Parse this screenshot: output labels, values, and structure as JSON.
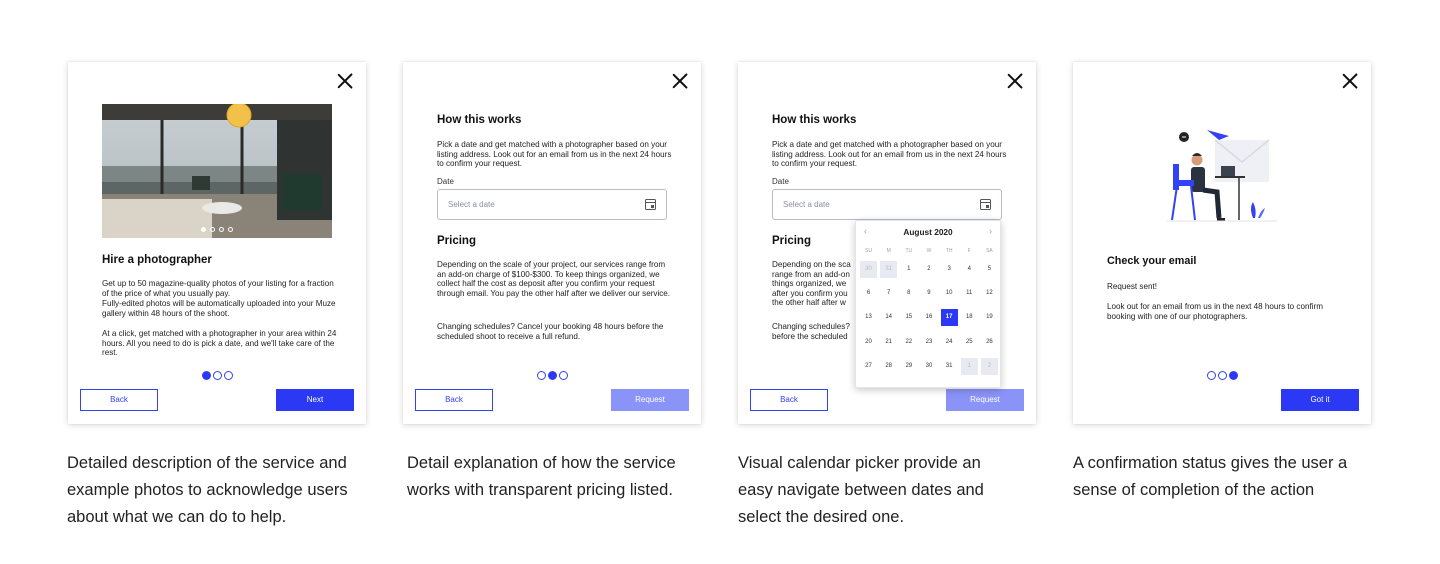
{
  "close_label": "×",
  "card1": {
    "title": "Hire a photographer",
    "para1": "Get up to 50 magazine-quality photos of your listing for a fraction of the price of what you usually pay.",
    "para2": "Fully-edited photos will be automatically uploaded into your Muze gallery within 48 hours of the shoot.",
    "para3": "At a click, get matched with a photographer in your area within 24 hours. All you need to do is pick a date, and we'll take care of the rest.",
    "back_label": "Back",
    "next_label": "Next",
    "step": 1
  },
  "card2": {
    "how_title": "How this works",
    "how_text": "Pick a date and get matched with a photographer based on your listing address. Look out for an email from us in the next 24 hours to confirm your request.",
    "date_label": "Date",
    "date_placeholder": "Select a date",
    "pricing_title": "Pricing",
    "pricing_text": "Depending on the scale of your project, our services range from an add-on charge of $100-$300. To keep things organized, we collect half the cost as deposit after you confirm your request through email. You pay the other half after we deliver our service.",
    "schedule_text": "Changing schedules? Cancel your booking 48 hours before the scheduled shoot to receive a full refund.",
    "back_label": "Back",
    "request_label": "Request",
    "step": 2
  },
  "card3": {
    "how_title": "How this works",
    "how_text": "Pick a date and get matched with a photographer based on your listing address. Look out for an email from us in the next 24 hours to confirm your request.",
    "date_label": "Date",
    "date_placeholder": "Select a date",
    "pricing_title": "Pricing",
    "pricing_lines": [
      "Depending on the sca",
      "range from an add-on",
      "things organized, we",
      "after you confirm you",
      "the other half after w"
    ],
    "schedule_lines": [
      "Changing schedules?",
      "before the scheduled"
    ],
    "back_label": "Back",
    "request_label": "Request",
    "calendar": {
      "prev": "‹",
      "next": "›",
      "month": "August 2020",
      "weekdays": [
        "SU",
        "M",
        "TU",
        "W",
        "TH",
        "F",
        "SA"
      ],
      "weeks": [
        [
          "30",
          "31",
          "1",
          "2",
          "3",
          "4",
          "5"
        ],
        [
          "6",
          "7",
          "8",
          "9",
          "10",
          "11",
          "12"
        ],
        [
          "13",
          "14",
          "15",
          "16",
          "17",
          "18",
          "19"
        ],
        [
          "20",
          "21",
          "22",
          "23",
          "24",
          "25",
          "26"
        ],
        [
          "27",
          "28",
          "29",
          "30",
          "31",
          "1",
          "2"
        ]
      ],
      "selected": "17"
    }
  },
  "card4": {
    "title": "Check your email",
    "status": "Request sent!",
    "message": "Look out for an email from us in the next 48 hours to confirm booking with one of our photographers.",
    "cta_label": "Got it",
    "step": 3
  },
  "captions": [
    "Detailed description of the service and example photos to acknowledge users about what we can do to help.",
    "Detail explanation of how the service works with transparent pricing listed.",
    "Visual calendar picker provide an easy navigate between dates and select the desired one.",
    "A confirmation status gives the user a sense of completion of the action"
  ],
  "colors": {
    "accent": "#2b39f5",
    "accent_disabled": "#8a93f8",
    "muted_day": "#e7eaf0"
  }
}
